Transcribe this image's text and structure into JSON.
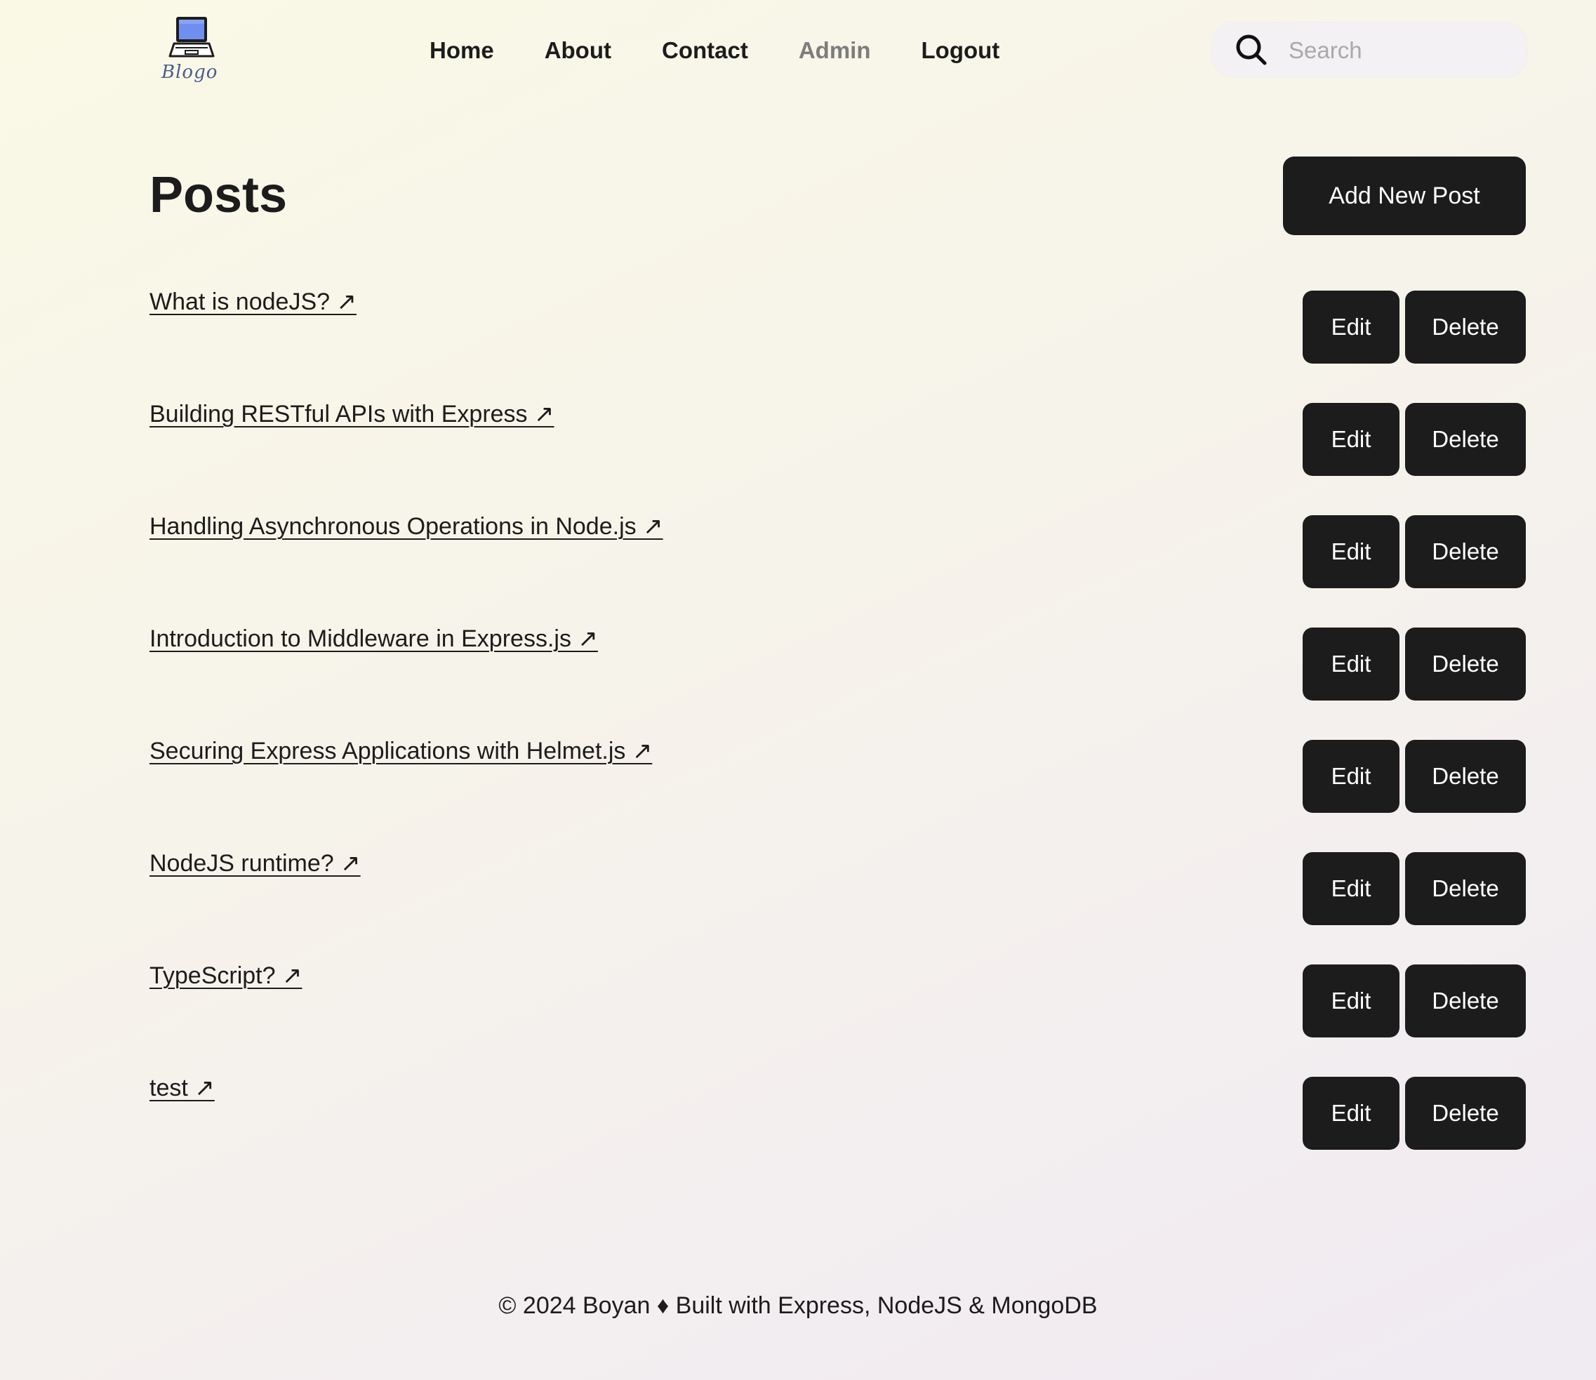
{
  "header": {
    "logo_text": "Blogo",
    "nav": [
      {
        "label": "Home",
        "active": false
      },
      {
        "label": "About",
        "active": false
      },
      {
        "label": "Contact",
        "active": false
      },
      {
        "label": "Admin",
        "active": true
      },
      {
        "label": "Logout",
        "active": false
      }
    ],
    "search": {
      "value": "",
      "placeholder": "Search"
    }
  },
  "main": {
    "title": "Posts",
    "add_button_label": "Add New Post",
    "posts": [
      {
        "title": "What is nodeJS? ↗",
        "edit_label": "Edit",
        "delete_label": "Delete"
      },
      {
        "title": "Building RESTful APIs with Express ↗",
        "edit_label": "Edit",
        "delete_label": "Delete"
      },
      {
        "title": "Handling Asynchronous Operations in Node.js ↗",
        "edit_label": "Edit",
        "delete_label": "Delete"
      },
      {
        "title": "Introduction to Middleware in Express.js ↗",
        "edit_label": "Edit",
        "delete_label": "Delete"
      },
      {
        "title": "Securing Express Applications with Helmet.js ↗",
        "edit_label": "Edit",
        "delete_label": "Delete"
      },
      {
        "title": "NodeJS runtime? ↗",
        "edit_label": "Edit",
        "delete_label": "Delete"
      },
      {
        "title": "TypeScript? ↗",
        "edit_label": "Edit",
        "delete_label": "Delete"
      },
      {
        "title": "test ↗",
        "edit_label": "Edit",
        "delete_label": "Delete"
      }
    ]
  },
  "footer": {
    "text": "© 2024 Boyan ♦ Built with Express, NodeJS & MongoDB"
  },
  "colors": {
    "button_bg": "#1c1c1c",
    "button_text": "#ffffff",
    "nav_active": "#7d7d7d",
    "search_bg": "#f3f1f3",
    "logo_screen": "#6f8ff0"
  },
  "icons": {
    "logo": "laptop-icon",
    "search": "search-icon"
  }
}
